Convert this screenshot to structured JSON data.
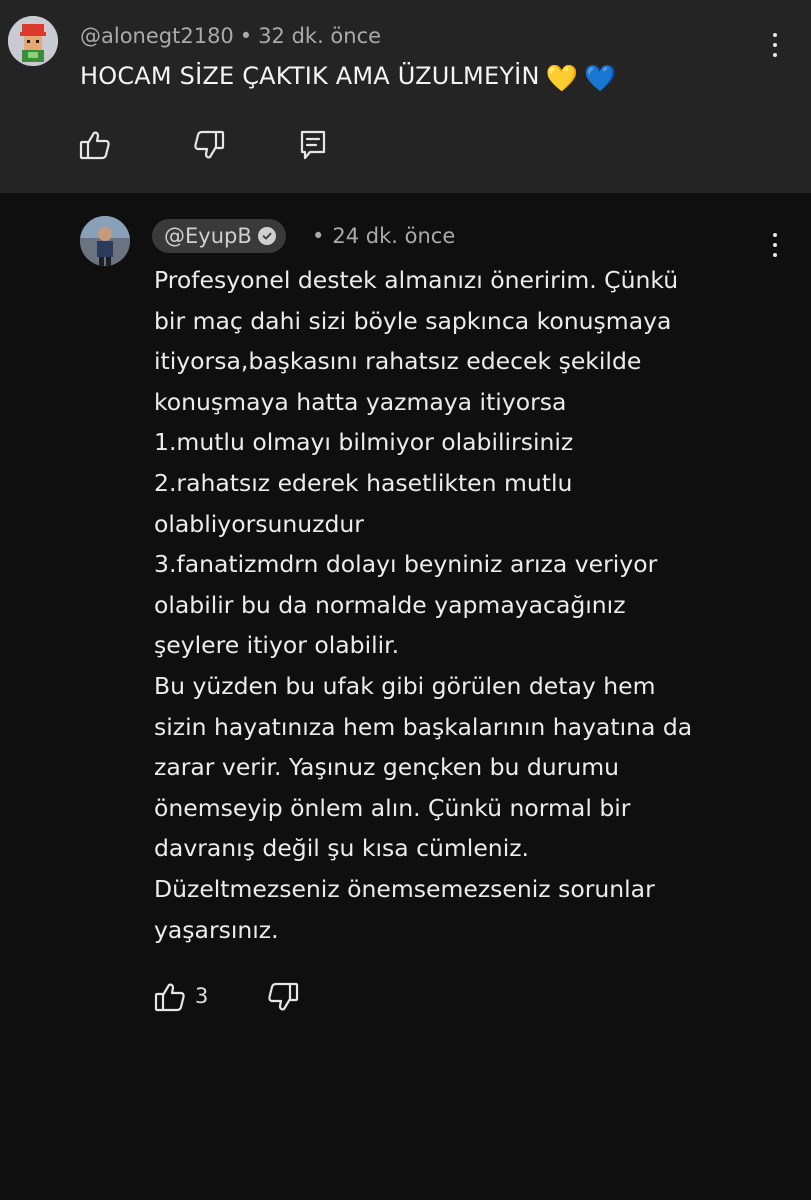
{
  "parent_comment": {
    "username": "@alonegt2180",
    "separator": "•",
    "time": "32 dk. önce",
    "text": "HOCAM SİZE ÇAKTIK AMA ÜZULMEYİN",
    "emojis": [
      "💛",
      "💙"
    ],
    "actions": {
      "like_icon": "thumb-up-icon",
      "dislike_icon": "thumb-down-icon",
      "reply_icon": "comment-reply-icon"
    }
  },
  "reply": {
    "username": "@EyupB",
    "verified_icon": "verified-check-icon",
    "separator": "•",
    "time": "24 dk. önce",
    "lines": [
      "Profesyonel destek almanızı öneririm. Çünkü",
      "bir maç dahi sizi böyle sapkınca konuşmaya",
      "itiyorsa,başkasını rahatsız edecek şekilde",
      "konuşmaya hatta yazmaya itiyorsa",
      "1.mutlu olmayı bilmiyor olabilirsiniz",
      "2.rahatsız ederek hasetlikten mutlu",
      "olabliyorsunuzdur",
      "3.fanatizmdrn dolayı beyniniz arıza veriyor",
      "olabilir bu da normalde yapmayacağınız",
      "şeylere itiyor olabilir.",
      "Bu yüzden bu ufak gibi görülen detay hem",
      "sizin hayatınıza hem başkalarının hayatına da",
      "zarar verir. Yaşınuz gençken bu durumu",
      "önemseyip önlem alın. Çünkü normal bir",
      "davranış değil şu kısa cümleniz.",
      "Düzeltmezseniz önemsemezseniz sorunlar",
      "yaşarsınız."
    ],
    "like_count": "3",
    "actions": {
      "like_icon": "thumb-up-icon",
      "dislike_icon": "thumb-down-icon"
    }
  },
  "colors": {
    "background": "#0f0f0f",
    "parent_background": "#242424",
    "text_primary": "#f1f1f1",
    "text_secondary": "#aaaaaa",
    "chip_background": "#3a3a3a"
  }
}
